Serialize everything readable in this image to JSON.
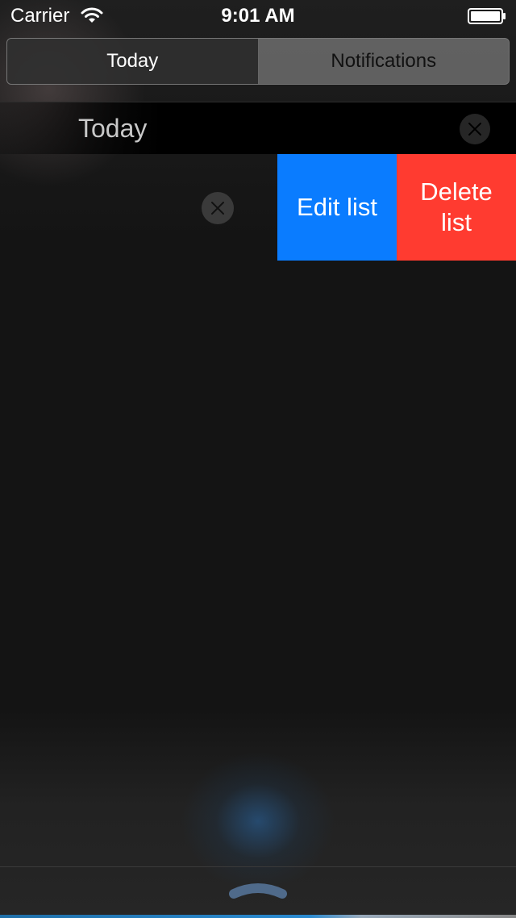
{
  "status_bar": {
    "carrier": "Carrier",
    "time": "9:01 AM"
  },
  "segmented_control": {
    "tabs": [
      {
        "label": "Today",
        "selected": true
      },
      {
        "label": "Notifications",
        "selected": false
      }
    ]
  },
  "section": {
    "title": "Today"
  },
  "row_actions": {
    "edit_label": "Edit list",
    "delete_label": "Delete list"
  },
  "colors": {
    "edit": "#0a7cff",
    "delete": "#ff3b30",
    "background": "#141414"
  },
  "icons": [
    "wifi-icon",
    "battery-icon",
    "close-icon",
    "chevron-up-icon"
  ]
}
